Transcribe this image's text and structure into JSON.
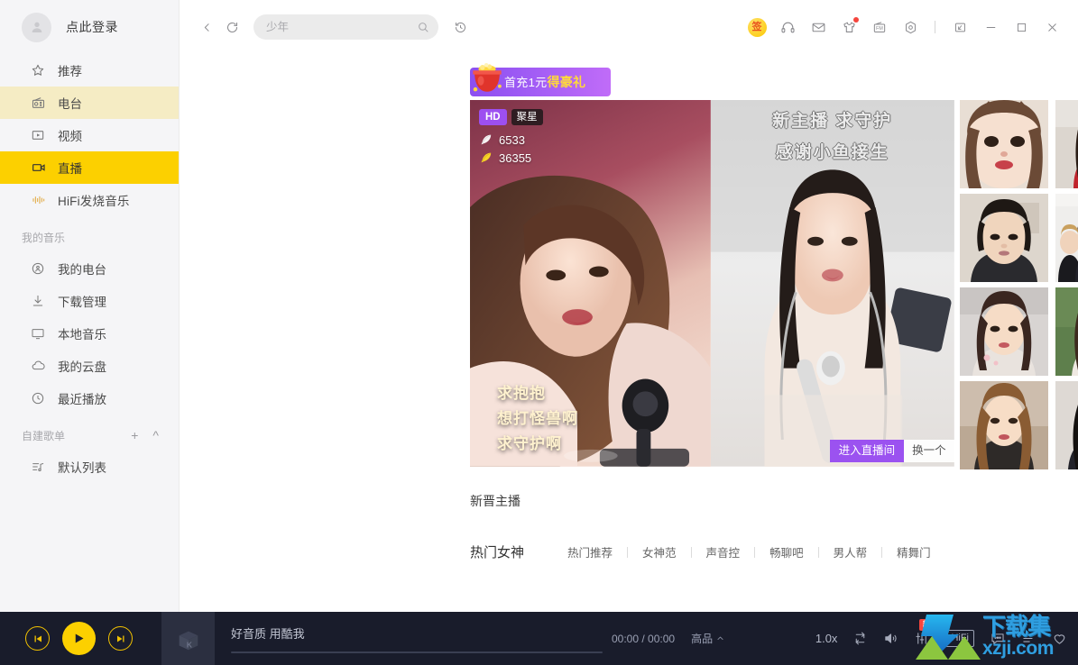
{
  "sidebar": {
    "user": {
      "login_label": "点此登录",
      "avatar_icon": "user-avatar-placeholder"
    },
    "nav": [
      {
        "label": "推荐",
        "icon": "star-icon",
        "state": "normal"
      },
      {
        "label": "电台",
        "icon": "radio-icon",
        "state": "hover"
      },
      {
        "label": "视频",
        "icon": "video-icon",
        "state": "normal"
      },
      {
        "label": "直播",
        "icon": "live-camera-icon",
        "state": "active"
      },
      {
        "label": "HiFi发烧音乐",
        "icon": "waveform-icon",
        "state": "normal"
      }
    ],
    "my_music_title": "我的音乐",
    "my_music": [
      {
        "label": "我的电台",
        "icon": "my-radio-icon"
      },
      {
        "label": "下载管理",
        "icon": "download-icon"
      },
      {
        "label": "本地音乐",
        "icon": "monitor-icon"
      },
      {
        "label": "我的云盘",
        "icon": "cloud-icon"
      },
      {
        "label": "最近播放",
        "icon": "clock-icon"
      }
    ],
    "playlist_title": "自建歌单",
    "playlist_add_icon": "plus-icon",
    "playlist_collapse_icon": "chevron-up-icon",
    "playlists": [
      {
        "label": "默认列表",
        "icon": "playlist-icon"
      }
    ]
  },
  "toolbar": {
    "back_icon": "chevron-left-icon",
    "refresh_icon": "refresh-icon",
    "search": {
      "placeholder": "少年",
      "value": "",
      "icon": "search-icon"
    },
    "history_icon": "history-clock-icon",
    "right_icons": [
      {
        "name": "signin-badge",
        "label": "签"
      },
      {
        "name": "headphones-icon",
        "label": ""
      },
      {
        "name": "mail-icon",
        "label": ""
      },
      {
        "name": "shirt-icon",
        "label": "",
        "dot": true
      },
      {
        "name": "fm-icon",
        "label": "FM"
      },
      {
        "name": "settings-icon",
        "label": ""
      }
    ],
    "window_controls": [
      {
        "name": "mini-mode-button",
        "glyph": "mini"
      },
      {
        "name": "minimize-button",
        "glyph": "minimize"
      },
      {
        "name": "maximize-button",
        "glyph": "maximize"
      },
      {
        "name": "close-button",
        "glyph": "close"
      }
    ]
  },
  "promo": {
    "icon": "treasure-pot-icon",
    "text_plain": "首充1元",
    "text_highlight": "得豪礼"
  },
  "live": {
    "card_a": {
      "badge_hd": "HD",
      "badge_star": "聚星",
      "counts": [
        {
          "icon": "white-feather-icon",
          "value": "6533"
        },
        {
          "icon": "yellow-feather-icon",
          "value": "36355"
        }
      ],
      "caption_lines": [
        "求抱抱",
        "想打怪兽啊",
        "求守护啊"
      ]
    },
    "card_b": {
      "caption_lines": [
        "新主播 求守护",
        "感谢小鱼接生"
      ],
      "enter_button": "进入直播间",
      "change_button": "换一个"
    },
    "thumbnails": [
      {
        "name": "thumb-anchor-1"
      },
      {
        "name": "thumb-anchor-2"
      },
      {
        "name": "thumb-anchor-3"
      },
      {
        "name": "thumb-anchor-4"
      },
      {
        "name": "thumb-anchor-5"
      },
      {
        "name": "thumb-anchor-6"
      },
      {
        "name": "thumb-anchor-7"
      },
      {
        "name": "thumb-anchor-8"
      }
    ]
  },
  "sections": {
    "new_anchors_title": "新晋主播",
    "category_main": "热门女神",
    "categories": [
      "热门推荐",
      "女神范",
      "声音控",
      "畅聊吧",
      "男人帮",
      "精舞门"
    ]
  },
  "player": {
    "prev_icon": "previous-track-icon",
    "play_icon": "play-icon",
    "next_icon": "next-track-icon",
    "cover_icon": "kuwo-album-placeholder-icon",
    "track_name": "好音质 用酷我",
    "time": "00:00 / 00:00",
    "quality": "高品",
    "quality_caret_icon": "chevron-up-icon",
    "speed": "1.0x",
    "loop_icon": "repeat-icon",
    "volume_icon": "volume-icon",
    "equalizer_icon": "equalizer-icon",
    "equalizer_new_tag": "新",
    "hifi_label": "HiFi",
    "comment_icon": "comment-icon",
    "favorite_icon": "heart-icon",
    "playlist_icon": "playlist-queue-icon"
  },
  "watermark": {
    "cn": "下载集",
    "en": "xzji.com",
    "logo_icon": "download-arrow-logo-icon"
  },
  "colors": {
    "accent_yellow": "#fcd000",
    "hover_yellow": "#f5ecc4",
    "sidebar_bg": "#f5f5f7",
    "player_bg": "#191c2b",
    "purple": "#9b52f0",
    "red_dot": "#f5453d",
    "watermark_blue": "#2f9ee0"
  }
}
